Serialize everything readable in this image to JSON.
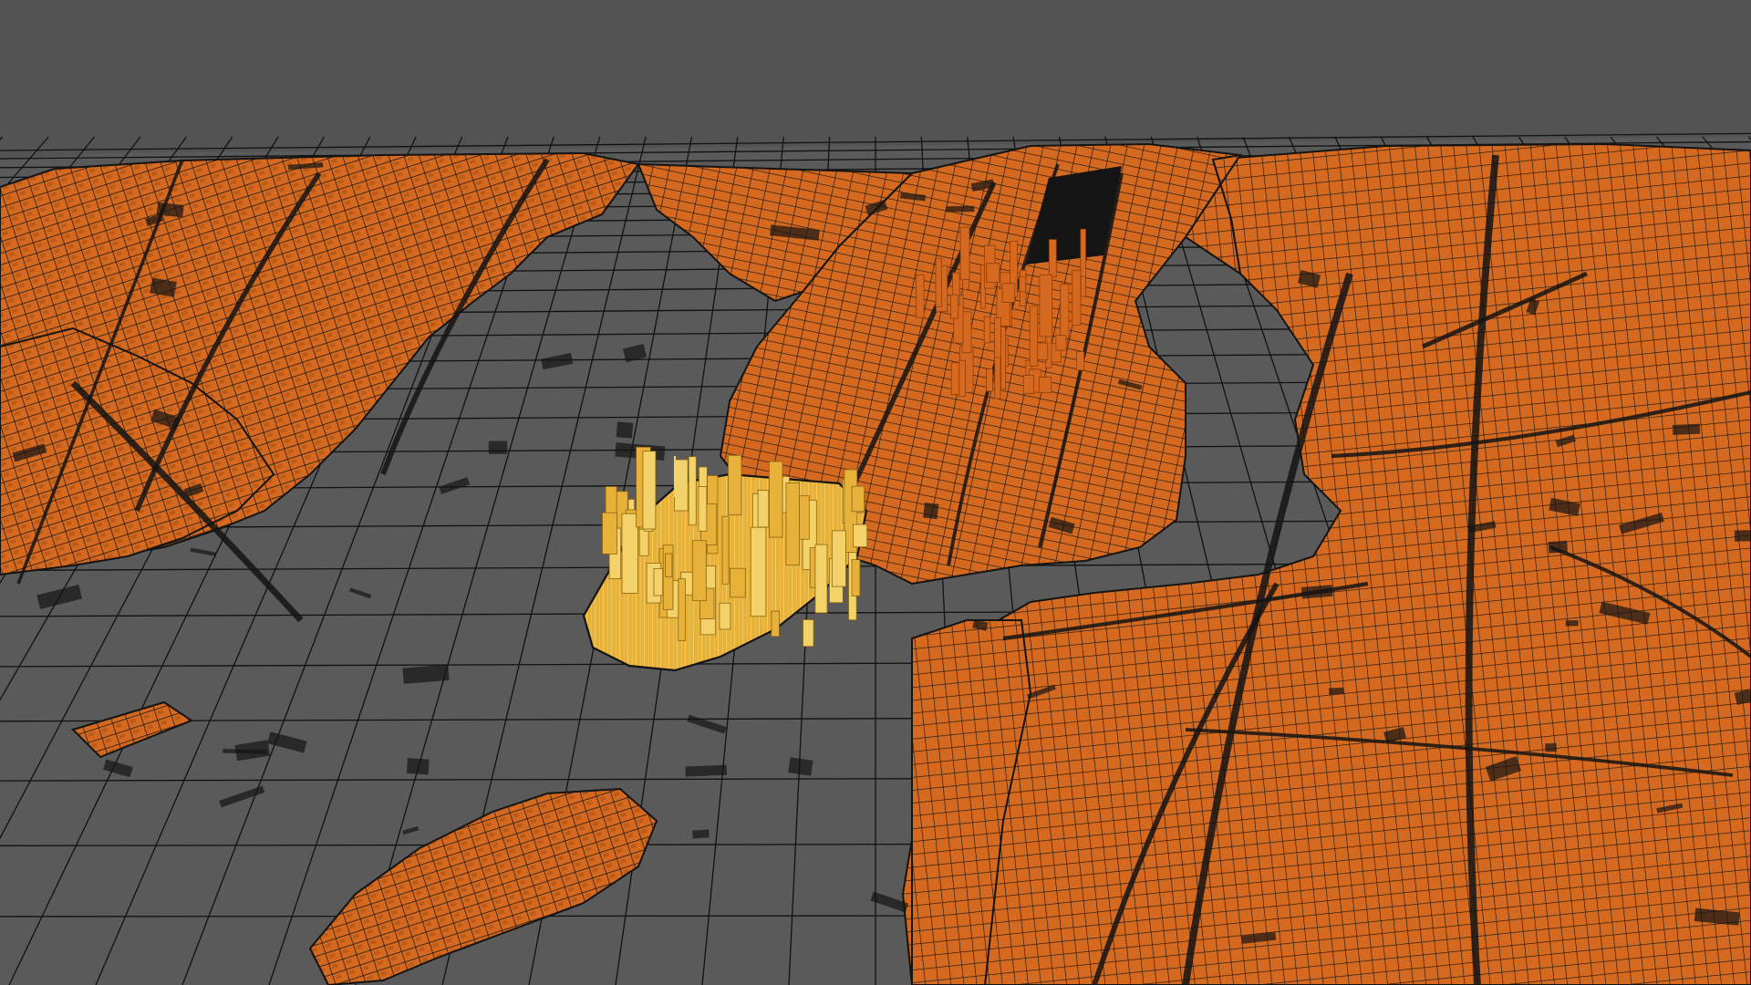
{
  "viewport": {
    "kind": "3d-perspective-view",
    "background_color": "#535353"
  },
  "scene": {
    "model": "city-blocks-wireframe",
    "grid": {
      "visible": true,
      "fill_color": "#5a5a5a",
      "line_color": "#111111"
    },
    "land_color": "#d4691f",
    "land_shadow_color": "#8f3e0c",
    "outline_color": "#141414",
    "selection": {
      "state": "highlighted",
      "color": "#e7b13a",
      "light_color": "#f4d26a"
    }
  }
}
